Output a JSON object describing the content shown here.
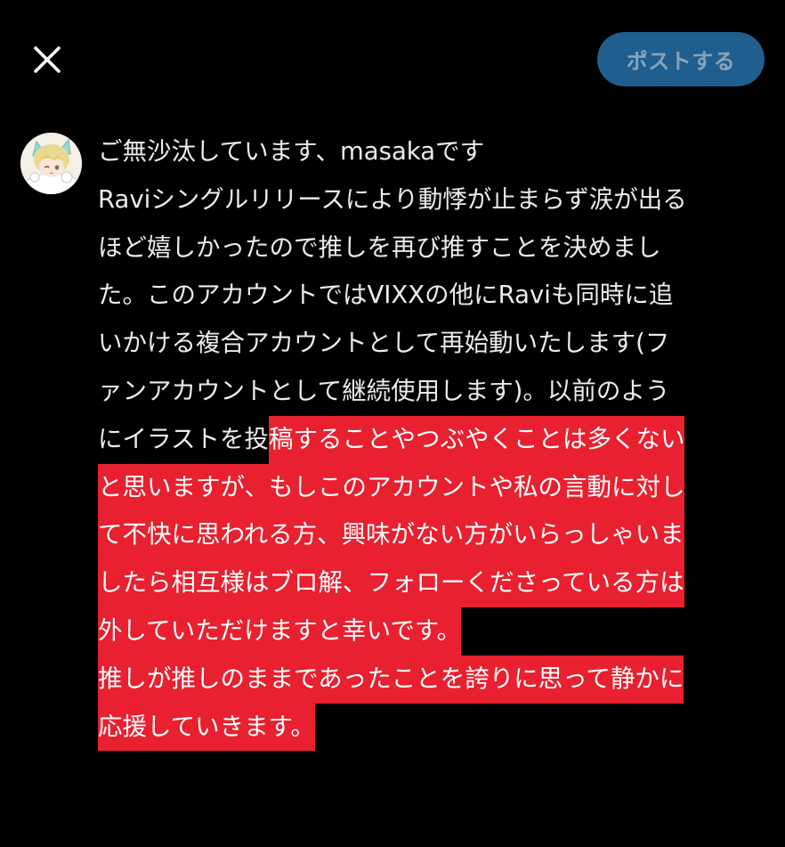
{
  "header": {
    "close_icon": "close-icon",
    "post_label": "ポストする",
    "post_color": "#1f5e8e"
  },
  "avatar": {
    "icon": "avatar-illustration"
  },
  "composer": {
    "highlight_color": "#e8202f",
    "lines": [
      {
        "plain": "ご無沙汰しています、masakaです",
        "highlight": ""
      },
      {
        "plain": "Raviシングルリリースにより動悸が止まらず涙が出る",
        "highlight": ""
      },
      {
        "plain": "ほど嬉しかったので推しを再び推すことを決めまし",
        "highlight": ""
      },
      {
        "plain": "た。このアカウントではVIXXの他にRaviも同時に追",
        "highlight": ""
      },
      {
        "plain": "いかける複合アカウントとして再始動いたします(フ",
        "highlight": ""
      },
      {
        "plain": "ァンアカウントとして継続使用します)。以前のよう",
        "highlight": ""
      },
      {
        "plain": "にイラストを投",
        "highlight": "稿することやつぶやくことは多くない"
      },
      {
        "plain": "",
        "highlight": "と思いますが、もしこのアカウントや私の言動に対し"
      },
      {
        "plain": "",
        "highlight": "て不快に思われる方、興味がない方がいらっしゃいま"
      },
      {
        "plain": "",
        "highlight": "したら相互様はブロ解、フォローくださっている方は"
      },
      {
        "plain": "",
        "highlight": "外していただけますと幸いです。"
      },
      {
        "plain": "",
        "highlight": "推しが推しのままであったことを誇りに思って静かに"
      },
      {
        "plain": "",
        "highlight": "応援していきます。"
      }
    ]
  }
}
